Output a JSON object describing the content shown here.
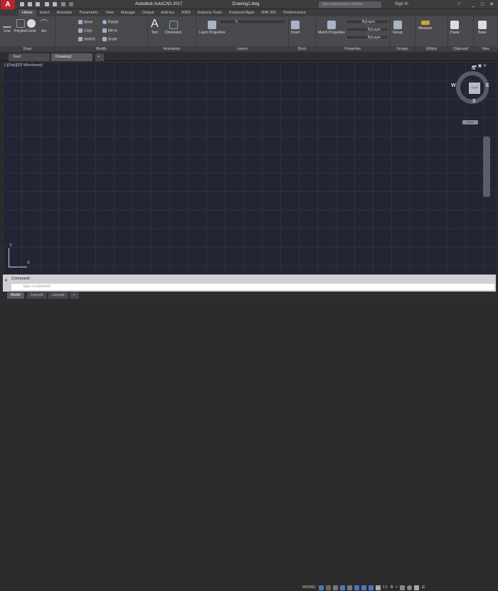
{
  "app": {
    "logo": "A",
    "title": "Autodesk AutoCAD 2017",
    "file": "Drawing1.dwg",
    "search_placeholder": "Type a keyword or phrase",
    "sign_in": "Sign In",
    "help": "?"
  },
  "ribbon_tabs": [
    "Home",
    "Insert",
    "Annotate",
    "Parametric",
    "View",
    "Manage",
    "Output",
    "Add-ins",
    "A360",
    "Express Tools",
    "Featured Apps",
    "BIM 360",
    "Performance"
  ],
  "panels": {
    "draw": {
      "label": "Draw",
      "tools": [
        "Line",
        "Polyline",
        "Circle",
        "Arc"
      ]
    },
    "modify": {
      "label": "Modify",
      "tools": [
        "Move",
        "Rotate",
        "Copy",
        "Mirror",
        "Stretch",
        "Scale"
      ]
    },
    "annotation": {
      "label": "Annotation",
      "tools": [
        "Text",
        "Dimension"
      ]
    },
    "layers": {
      "label": "Layers",
      "tools": [
        "Layer Properties"
      ],
      "current": "0"
    },
    "block": {
      "label": "Block",
      "tools": [
        "Insert"
      ]
    },
    "properties": {
      "label": "Properties",
      "tools": [
        "Match Properties"
      ],
      "color": "ByLayer",
      "linetype": "ByLayer",
      "lineweight": "ByLayer"
    },
    "groups": {
      "label": "Groups",
      "tools": [
        "Group"
      ]
    },
    "utilities": {
      "label": "Utilities",
      "tools": [
        "Measure"
      ]
    },
    "clipboard": {
      "label": "Clipboard",
      "tools": [
        "Paste"
      ]
    },
    "view": {
      "label": "View",
      "tools": [
        "Base"
      ]
    }
  },
  "doc_tabs": [
    "Start",
    "Drawing1"
  ],
  "viewport": {
    "label": "[-][Top][2D Wireframe]",
    "compass": {
      "n": "N",
      "s": "S",
      "e": "E",
      "w": "W",
      "face": "TOP"
    },
    "wcs": "WCS",
    "ucs_x": "X",
    "ucs_y": "Y"
  },
  "command": {
    "history": "Command:",
    "placeholder": "Type a command"
  },
  "layout_tabs": [
    "Model",
    "Layout1",
    "Layout2",
    "+"
  ],
  "status": {
    "space": "MODEL",
    "scale": "1:1"
  },
  "colors": {
    "viewport_bg": "#222634",
    "accent": "#b8262b",
    "ribbon": "#4a4a4e"
  }
}
